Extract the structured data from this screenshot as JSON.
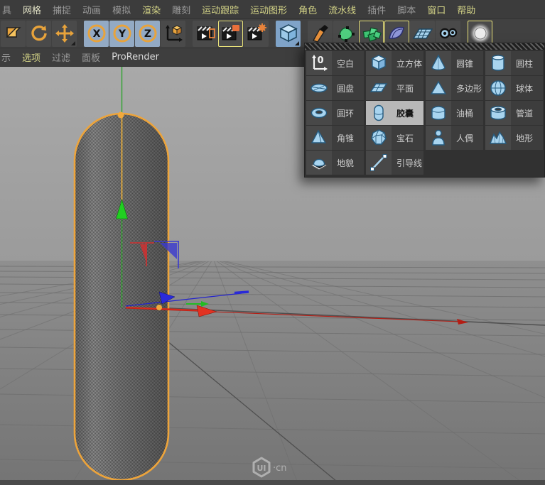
{
  "menubar": {
    "items": [
      {
        "label": "具",
        "tone": "gray"
      },
      {
        "label": "网格",
        "tone": "bright"
      },
      {
        "label": "捕捉",
        "tone": "gray"
      },
      {
        "label": "动画",
        "tone": "gray"
      },
      {
        "label": "模拟",
        "tone": "gray"
      },
      {
        "label": "渲染",
        "tone": "yellow"
      },
      {
        "label": "雕刻",
        "tone": "gray"
      },
      {
        "label": "运动跟踪",
        "tone": "yellow"
      },
      {
        "label": "运动图形",
        "tone": "yellow"
      },
      {
        "label": "角色",
        "tone": "yellow"
      },
      {
        "label": "流水线",
        "tone": "yellow"
      },
      {
        "label": "插件",
        "tone": "gray"
      },
      {
        "label": "脚本",
        "tone": "gray"
      },
      {
        "label": "窗口",
        "tone": "yellow"
      },
      {
        "label": "帮助",
        "tone": "yellow"
      }
    ]
  },
  "toolbar": {
    "buttons": [
      {
        "icon": "make-editable-icon",
        "style": ""
      },
      {
        "icon": "rotate-tool-icon",
        "style": ""
      },
      {
        "icon": "move-tool-icon",
        "style": "flyout"
      },
      {
        "icon": "lock-x-icon",
        "style": "bluebg gap",
        "letter": "X"
      },
      {
        "icon": "lock-y-icon",
        "style": "bluebg",
        "letter": "Y"
      },
      {
        "icon": "lock-z-icon",
        "style": "bluebg",
        "letter": "Z"
      },
      {
        "icon": "coordinate-system-icon",
        "style": ""
      },
      {
        "icon": "render-view-icon",
        "style": "gap"
      },
      {
        "icon": "render-settings-icon",
        "style": "active"
      },
      {
        "icon": "render-queue-icon",
        "style": ""
      },
      {
        "icon": "primitive-cube-icon",
        "style": "cubebg gap flyout"
      },
      {
        "icon": "pen-tool-icon",
        "style": "gap"
      },
      {
        "icon": "spline-shape-icon",
        "style": ""
      },
      {
        "icon": "volume-cubes-icon",
        "style": "active"
      },
      {
        "icon": "subdivision-surface-icon",
        "style": "active"
      },
      {
        "icon": "floor-icon",
        "style": ""
      },
      {
        "icon": "camera-rings-icon",
        "style": ""
      },
      {
        "icon": "light-sphere-icon",
        "style": "active gap"
      }
    ]
  },
  "viewmenu": {
    "items": [
      {
        "label": "示",
        "tone": "gray"
      },
      {
        "label": "选项",
        "tone": "yellow"
      },
      {
        "label": "过滤",
        "tone": "gray"
      },
      {
        "label": "面板",
        "tone": "gray"
      },
      {
        "label": "ProRender",
        "tone": "white"
      }
    ]
  },
  "primitive_menu": {
    "items": [
      {
        "label": "空白",
        "icon": "null-axis-icon",
        "selected": false
      },
      {
        "label": "立方体",
        "icon": "cube-icon",
        "selected": false
      },
      {
        "label": "圆锥",
        "icon": "cone-icon",
        "selected": false
      },
      {
        "label": "圆柱",
        "icon": "cylinder-icon",
        "selected": false
      },
      {
        "label": "圆盘",
        "icon": "disc-icon",
        "selected": false
      },
      {
        "label": "平面",
        "icon": "plane-icon",
        "selected": false
      },
      {
        "label": "多边形",
        "icon": "polygon-icon",
        "selected": false
      },
      {
        "label": "球体",
        "icon": "sphere-icon",
        "selected": false
      },
      {
        "label": "圆环",
        "icon": "torus-icon",
        "selected": false
      },
      {
        "label": "胶囊",
        "icon": "capsule-icon",
        "selected": true
      },
      {
        "label": "油桶",
        "icon": "oil-tank-icon",
        "selected": false
      },
      {
        "label": "管道",
        "icon": "tube-icon",
        "selected": false
      },
      {
        "label": "角锥",
        "icon": "pyramid-icon",
        "selected": false
      },
      {
        "label": "宝石",
        "icon": "gem-icon",
        "selected": false
      },
      {
        "label": "人偶",
        "icon": "figure-icon",
        "selected": false
      },
      {
        "label": "地形",
        "icon": "landscape-icon",
        "selected": false
      },
      {
        "label": "地貌",
        "icon": "relief-icon",
        "selected": false
      },
      {
        "label": "引导线",
        "icon": "guide-icon",
        "selected": false
      }
    ]
  },
  "watermark": {
    "logo": "UI",
    "suffix": "·cn"
  },
  "colors": {
    "selection_outline": "#eda43b",
    "axis_x": "#cc2a1e",
    "axis_y": "#2fbf2f",
    "axis_z": "#2a2ad8",
    "menu_highlight": "#d4d487",
    "primitive_icon_blue": "#a8d4ef",
    "selected_item_bg": "#b8b8b8"
  }
}
